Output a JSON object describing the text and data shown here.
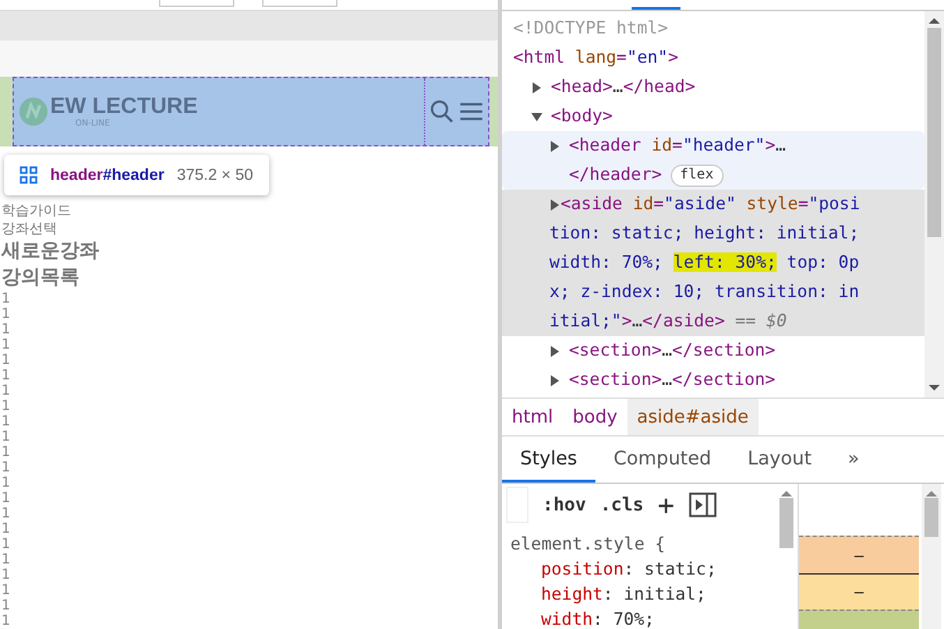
{
  "page": {
    "logo": {
      "name": "EW LECTURE",
      "sub": "ON-LINE"
    },
    "menu": [
      {
        "label": "학습가이드",
        "kind": "small"
      },
      {
        "label": "강좌선택",
        "kind": "small"
      },
      {
        "label": "새로운강좌",
        "kind": "big"
      },
      {
        "label": "강의목록",
        "kind": "big"
      }
    ],
    "numbers": [
      "1",
      "1",
      "1",
      "1",
      "1",
      "1",
      "1",
      "1",
      "1",
      "1",
      "1",
      "1",
      "1",
      "1",
      "1",
      "1",
      "1",
      "1",
      "1",
      "1",
      "1",
      "1"
    ]
  },
  "tooltip": {
    "tag": "header",
    "id": "#header",
    "size": "375.2 × 50"
  },
  "dom": [
    {
      "parts": [
        {
          "kind": "doctype",
          "s": "<!DOCTYPE html>"
        }
      ]
    },
    {
      "parts": [
        {
          "kind": "tag",
          "s": "<html "
        },
        {
          "kind": "attr",
          "s": "lang"
        },
        {
          "kind": "tag",
          "s": "="
        },
        {
          "kind": "val",
          "s": "\"en\""
        },
        {
          "kind": "tag",
          "s": ">"
        }
      ],
      "children": [
        {
          "expanded": false,
          "parts": [
            {
              "kind": "tag",
              "s": "<head>"
            },
            {
              "kind": "text",
              "s": "…"
            },
            {
              "kind": "tag",
              "s": "</head>"
            }
          ]
        },
        {
          "expanded": true,
          "parts": [
            {
              "kind": "tag",
              "s": "<body>"
            }
          ],
          "children": [
            {
              "expanded": false,
              "hovered": true,
              "parts": [
                {
                  "kind": "tag",
                  "s": "<header "
                },
                {
                  "kind": "attr",
                  "s": "id"
                },
                {
                  "kind": "tag",
                  "s": "="
                },
                {
                  "kind": "val",
                  "s": "\"header\""
                },
                {
                  "kind": "tag",
                  "s": ">"
                },
                {
                  "kind": "text",
                  "s": "…"
                }
              ],
              "close": "</header>",
              "badge": "flex"
            },
            {
              "expanded": false,
              "selected": true,
              "parts": [
                {
                  "kind": "tag",
                  "s": "<aside "
                },
                {
                  "kind": "attr",
                  "s": "id"
                },
                {
                  "kind": "tag",
                  "s": "="
                },
                {
                  "kind": "val",
                  "s": "\"aside\" "
                },
                {
                  "kind": "attr",
                  "s": "style"
                },
                {
                  "kind": "tag",
                  "s": "="
                },
                {
                  "kind": "val",
                  "s": "\"position: static; height: initial; width: 70%; "
                },
                {
                  "kind": "mark",
                  "s": "left: 30%;"
                },
                {
                  "kind": "val",
                  "s": " top: 0px; z-index: 10; transition: initial;\""
                },
                {
                  "kind": "tag",
                  "s": ">"
                },
                {
                  "kind": "text",
                  "s": "…"
                },
                {
                  "kind": "tag",
                  "s": "</aside>"
                },
                {
                  "kind": "ref",
                  "s": " == $0"
                }
              ]
            },
            {
              "expanded": false,
              "parts": [
                {
                  "kind": "tag",
                  "s": "<section>"
                },
                {
                  "kind": "text",
                  "s": "…"
                },
                {
                  "kind": "tag",
                  "s": "</section>"
                }
              ]
            },
            {
              "expanded": false,
              "parts": [
                {
                  "kind": "tag",
                  "s": "<section>"
                },
                {
                  "kind": "text",
                  "s": "…"
                },
                {
                  "kind": "tag",
                  "s": "</section>"
                }
              ]
            }
          ]
        }
      ]
    }
  ],
  "breadcrumbs": [
    {
      "label": "html",
      "selected": false
    },
    {
      "label": "body",
      "selected": false
    },
    {
      "label": "aside#aside",
      "selected": true
    }
  ],
  "tabs": [
    {
      "label": "Styles",
      "selected": true
    },
    {
      "label": "Computed",
      "selected": false
    },
    {
      "label": "Layout",
      "selected": false
    },
    {
      "label": "»",
      "selected": false
    }
  ],
  "toolbar": {
    "hov": ":hov",
    "cls": ".cls",
    "add": "+"
  },
  "styles": {
    "selector": "element.style {",
    "props": [
      {
        "name": "position",
        "value": ": static;"
      },
      {
        "name": "height",
        "value": ": initial;"
      },
      {
        "name": "width",
        "value": ": 70%;"
      }
    ]
  },
  "box_model": [
    "–",
    "–"
  ]
}
